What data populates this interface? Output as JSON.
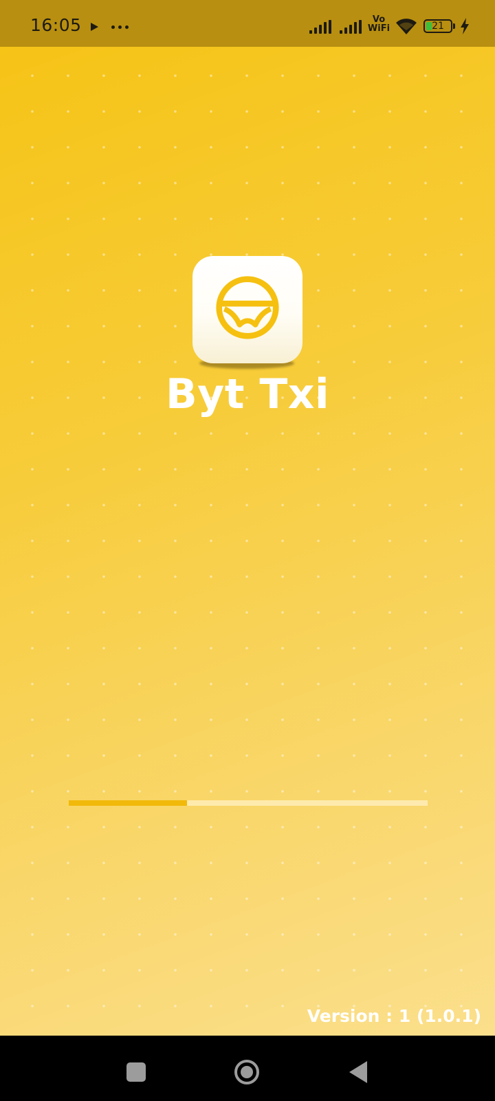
{
  "status_bar": {
    "time": "16:05",
    "network_label_top": "Vo",
    "network_label_bottom": "WiFi",
    "battery_level": "21",
    "icons": [
      "media-play-icon",
      "more-notifications-icon",
      "signal-icon",
      "signal-icon",
      "vowifi-icon",
      "wifi-icon",
      "battery-icon",
      "charging-icon"
    ]
  },
  "splash": {
    "app_name": "Byt Txi",
    "logo_icon": "steering-wheel-icon",
    "loading_progress": 0.33,
    "version": "Version : 1 (1.0.1)"
  },
  "colors": {
    "accent": "#f5c010",
    "background_top": "#f6c313",
    "background_bottom": "#fbdf8c",
    "status_bar": "#b88f10",
    "progress_fill": "#f1b90a"
  },
  "nav_bar": {
    "buttons": [
      "recents-button",
      "home-button",
      "back-button"
    ]
  }
}
